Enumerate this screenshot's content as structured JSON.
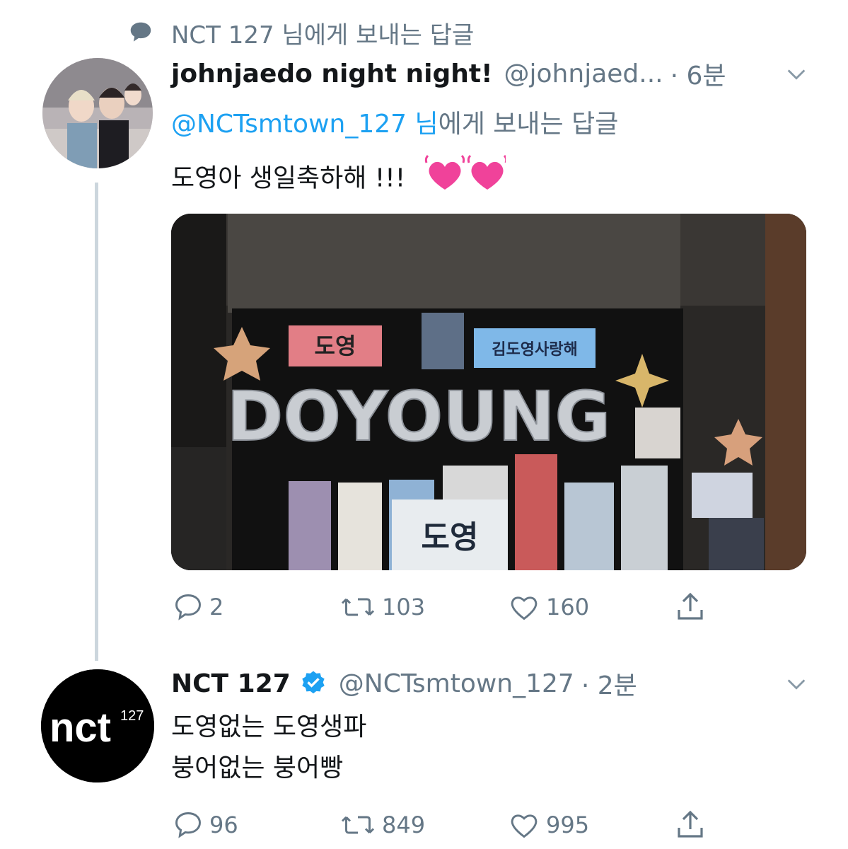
{
  "reply_context": {
    "text": "NCT 127 님에게 보내는 답글"
  },
  "tweet1": {
    "display_name": "johnjaedo night night!",
    "handle": "@johnjaed...",
    "time": "· 6분",
    "reply_mention": "@NCTsmtown_127 님",
    "reply_suffix": "에게 보내는 답글",
    "text": "도영아 생일축하해 !!!",
    "emoji": "💓 💓",
    "photo": {
      "banner_left": "도영",
      "banner_right": "김도영사랑해",
      "balloons": "DOYOUNG",
      "slogan": "도영"
    },
    "actions": {
      "replies": "2",
      "retweets": "103",
      "likes": "160"
    }
  },
  "tweet2": {
    "display_name": "NCT 127",
    "handle": "@NCTsmtown_127",
    "time": "· 2분",
    "avatar_text": "nct",
    "avatar_sup": "127",
    "text_line1": "도영없는 도영생파",
    "text_line2": "붕어없는 붕어빵",
    "actions": {
      "replies": "96",
      "retweets": "849",
      "likes": "995"
    }
  },
  "colors": {
    "accent": "#1da1f2",
    "secondary_text": "#657786",
    "primary_text": "#14171a",
    "thread_line": "#ccd6dd",
    "verified": "#1da1f2"
  }
}
